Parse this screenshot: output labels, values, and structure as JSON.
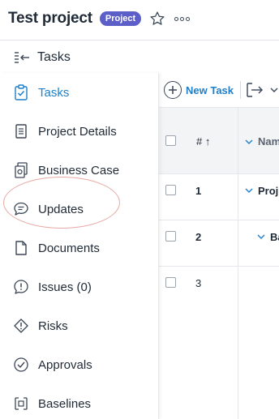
{
  "header": {
    "title": "Test project",
    "badge": "Project"
  },
  "panel": {
    "label": "Tasks"
  },
  "sidebar": {
    "items": [
      {
        "label": "Tasks",
        "icon": "clipboard-check-icon",
        "active": true
      },
      {
        "label": "Project Details",
        "icon": "document-icon"
      },
      {
        "label": "Business Case",
        "icon": "business-case-icon"
      },
      {
        "label": "Updates",
        "icon": "chat-bubble-icon"
      },
      {
        "label": "Documents",
        "icon": "file-icon"
      },
      {
        "label": "Issues (0)",
        "icon": "issue-alert-icon"
      },
      {
        "label": "Risks",
        "icon": "risk-diamond-icon"
      },
      {
        "label": "Approvals",
        "icon": "check-circle-icon"
      },
      {
        "label": "Baselines",
        "icon": "baseline-icon"
      }
    ]
  },
  "toolbar": {
    "new_task": "New Task"
  },
  "table": {
    "headers": {
      "num": "# ↑",
      "name": "Nam"
    },
    "rows": [
      {
        "num": "1",
        "name": "Proj"
      },
      {
        "num": "2",
        "name": "Ba"
      },
      {
        "num": "3",
        "name": ""
      }
    ]
  },
  "colors": {
    "accent": "#1f7fc8",
    "badge": "#5b5fc7",
    "highlight_ring": "#e7a9a3"
  }
}
